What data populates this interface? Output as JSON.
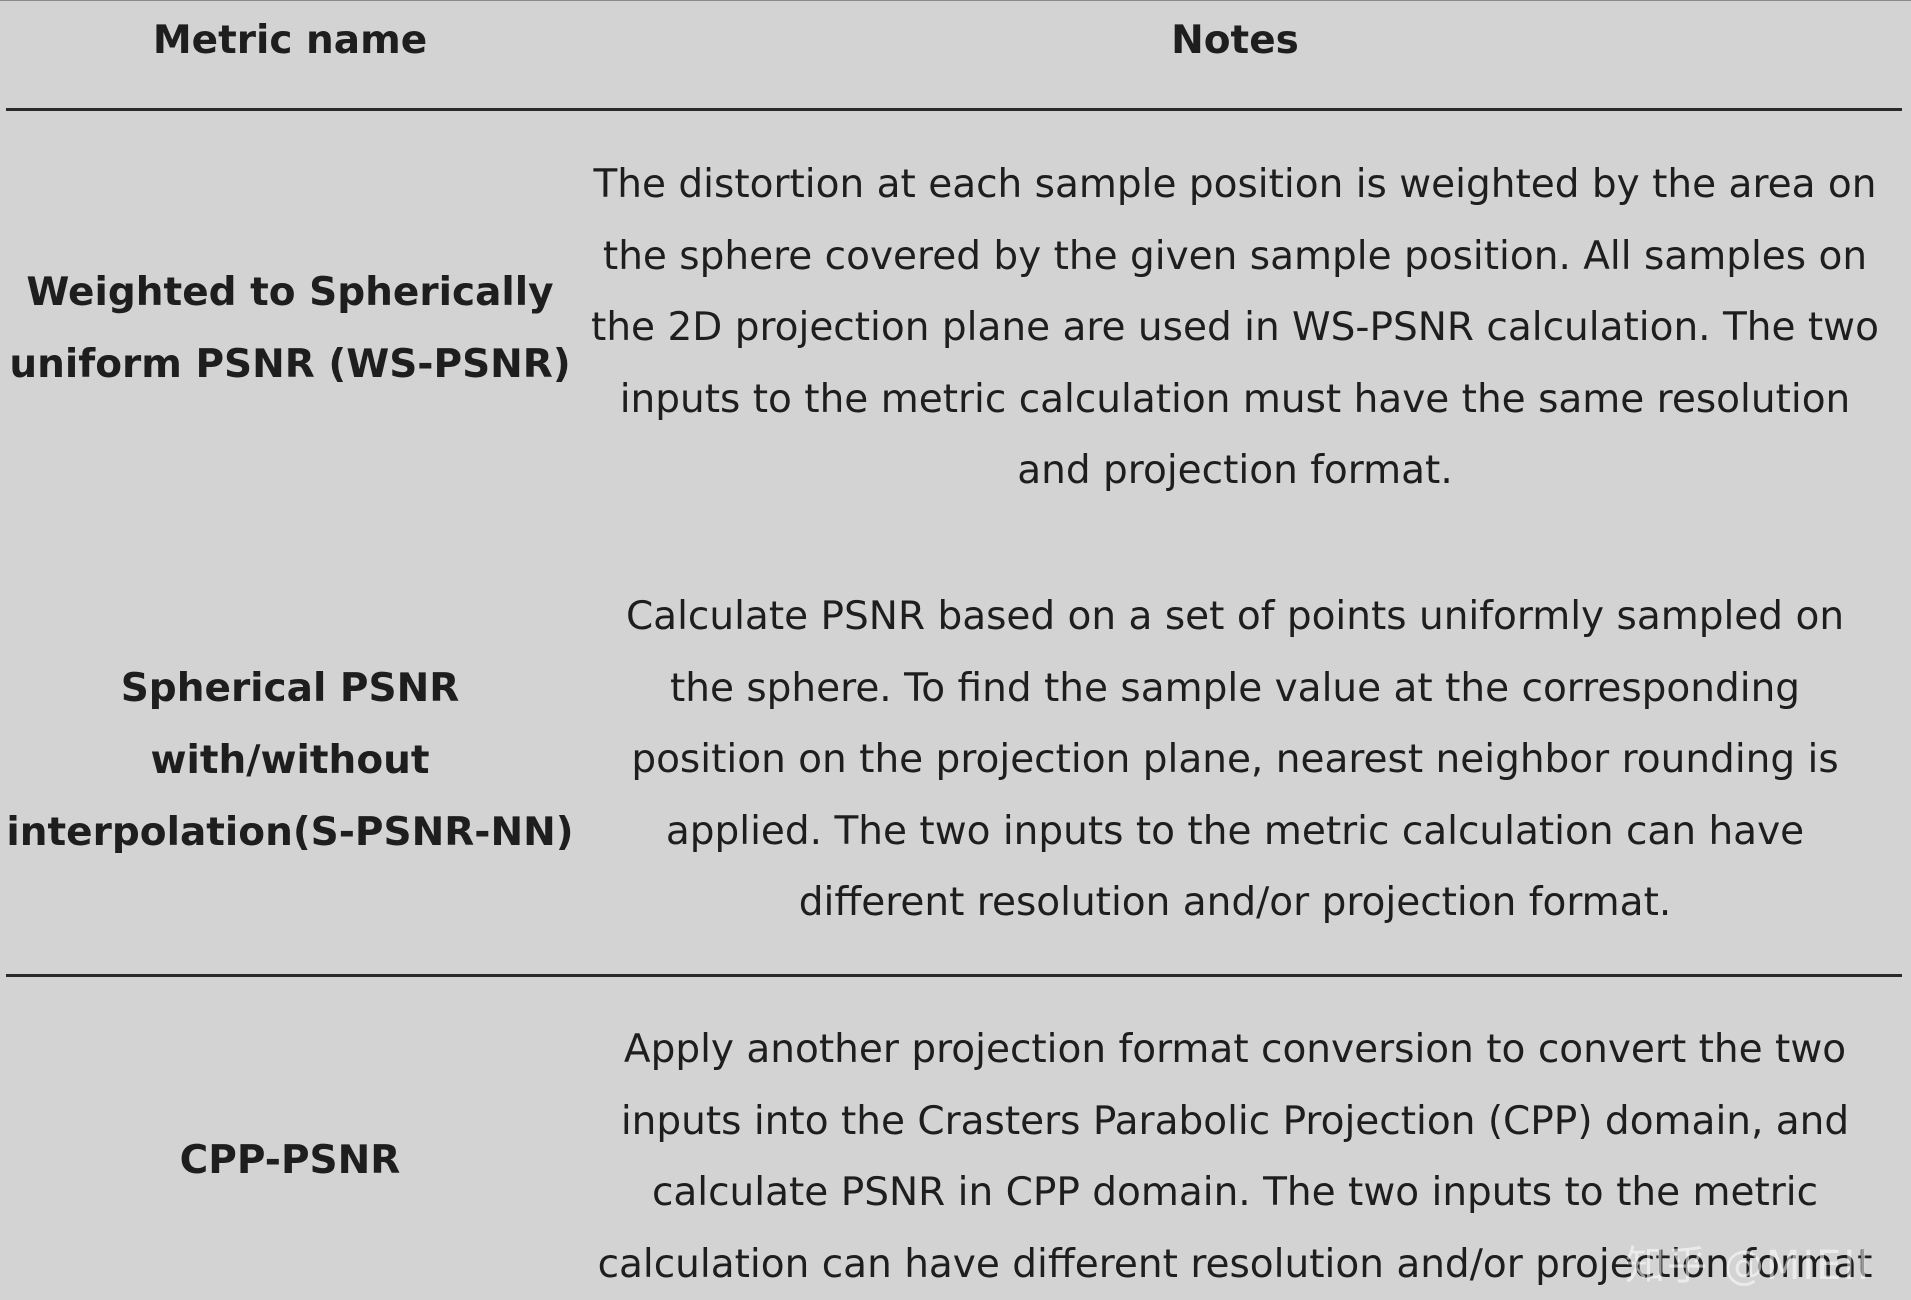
{
  "table": {
    "headers": {
      "metric_name": "Metric name",
      "notes": "Notes"
    },
    "rows": [
      {
        "metric_name": "Weighted to Spherically uniform PSNR (WS-PSNR)",
        "notes": "The distortion at each sample position is weighted by the area on the sphere covered by the given sample position. All samples on the 2D projection plane are used in WS-PSNR calculation. The two inputs to the metric calculation must have the same resolution and projection format."
      },
      {
        "metric_name": "Spherical PSNR with/without interpolation(S-PSNR-NN)",
        "notes": "Calculate PSNR based on a set of points uniformly sampled on the sphere. To find the sample value at the corresponding position on the projection plane, nearest neighbor rounding is applied. The two inputs to the metric calculation can have different resolution and/or projection format."
      },
      {
        "metric_name": "CPP-PSNR",
        "notes": "Apply another projection format conversion to convert the two inputs into the Crasters Parabolic Projection (CPP) domain, and calculate PSNR in CPP domain. The two inputs to the metric calculation can have different resolution and/or projection format"
      }
    ]
  },
  "watermark": "知乎 @MIEII"
}
